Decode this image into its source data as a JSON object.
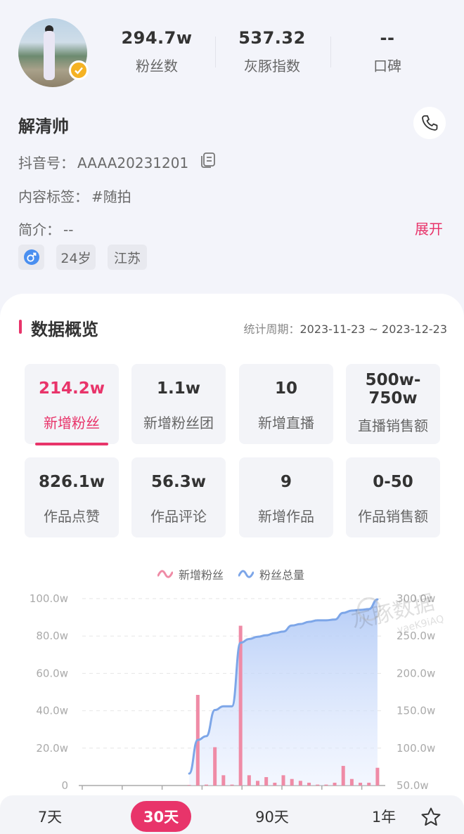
{
  "profile": {
    "name": "解清帅",
    "douyin_label": "抖音号：",
    "douyin_id": "AAAA20231201",
    "tags_label": "内容标签：",
    "tags_value": "#随拍",
    "bio_label": "简介：",
    "bio_value": "--",
    "expand_label": "展开",
    "gender_icon": "male-icon",
    "age": "24岁",
    "region": "江苏",
    "stats": [
      {
        "value": "294.7w",
        "label": "粉丝数"
      },
      {
        "value": "537.32",
        "label": "灰豚指数"
      },
      {
        "value": "--",
        "label": "口碑"
      }
    ]
  },
  "overview": {
    "title": "数据概览",
    "period_label": "统计周期：",
    "period_value": "2023-11-23 ~ 2023-12-23",
    "tiles": [
      {
        "value": "214.2w",
        "label": "新增粉丝",
        "active": true
      },
      {
        "value": "1.1w",
        "label": "新增粉丝团"
      },
      {
        "value": "10",
        "label": "新增直播"
      },
      {
        "value": "500w-\n750w",
        "label": "直播销售额"
      },
      {
        "value": "826.1w",
        "label": "作品点赞"
      },
      {
        "value": "56.3w",
        "label": "作品评论"
      },
      {
        "value": "9",
        "label": "新增作品"
      },
      {
        "value": "0-50",
        "label": "作品销售额"
      }
    ]
  },
  "chart_data": {
    "type": "bar",
    "legend": [
      "新增粉丝",
      "粉丝总量"
    ],
    "legend_position": "top",
    "y_left_ticks": [
      "0",
      "20.0w",
      "40.0w",
      "60.0w",
      "80.0w",
      "100.0w"
    ],
    "y_right_ticks": [
      "50.0w",
      "100.0w",
      "150.0w",
      "200.0w",
      "250.0w",
      "300.0w"
    ],
    "y_left_range": [
      0,
      100
    ],
    "y_right_range": [
      50,
      300
    ],
    "grid": true,
    "series": [
      {
        "name": "新增粉丝",
        "kind": "bar",
        "axis": "left",
        "color": "#ef8ba6",
        "values": [
          0,
          0,
          0,
          0,
          0,
          0,
          0,
          0,
          0,
          0,
          0,
          0,
          0.3,
          48.5,
          0.5,
          20.5,
          5.5,
          0.5,
          85.5,
          5.5,
          2.5,
          4.5,
          1.5,
          5.5,
          3.5,
          2.5,
          1.5,
          0.5,
          0.5,
          1.5,
          10.5,
          3.5,
          1.5,
          1.5,
          9.5
        ]
      },
      {
        "name": "粉丝总量",
        "kind": "area",
        "axis": "right",
        "color": "#7da6e8",
        "values": [
          null,
          null,
          null,
          null,
          null,
          null,
          null,
          null,
          null,
          null,
          null,
          null,
          66,
          111,
          116,
          151,
          156,
          156,
          241,
          246,
          249,
          251,
          254,
          256,
          264,
          266,
          269,
          271,
          271,
          272,
          281,
          284,
          285,
          286,
          299
        ]
      }
    ]
  },
  "ranges": [
    {
      "label": "7天"
    },
    {
      "label": "30天",
      "selected": true
    },
    {
      "label": "90天"
    },
    {
      "label": "1年"
    }
  ],
  "watermark": {
    "line1": "灰豚数据",
    "line2": "yaeK9iAQ"
  },
  "colors": {
    "accent": "#e8346a",
    "bar": "#ef8ba6",
    "line": "#7da6e8"
  }
}
